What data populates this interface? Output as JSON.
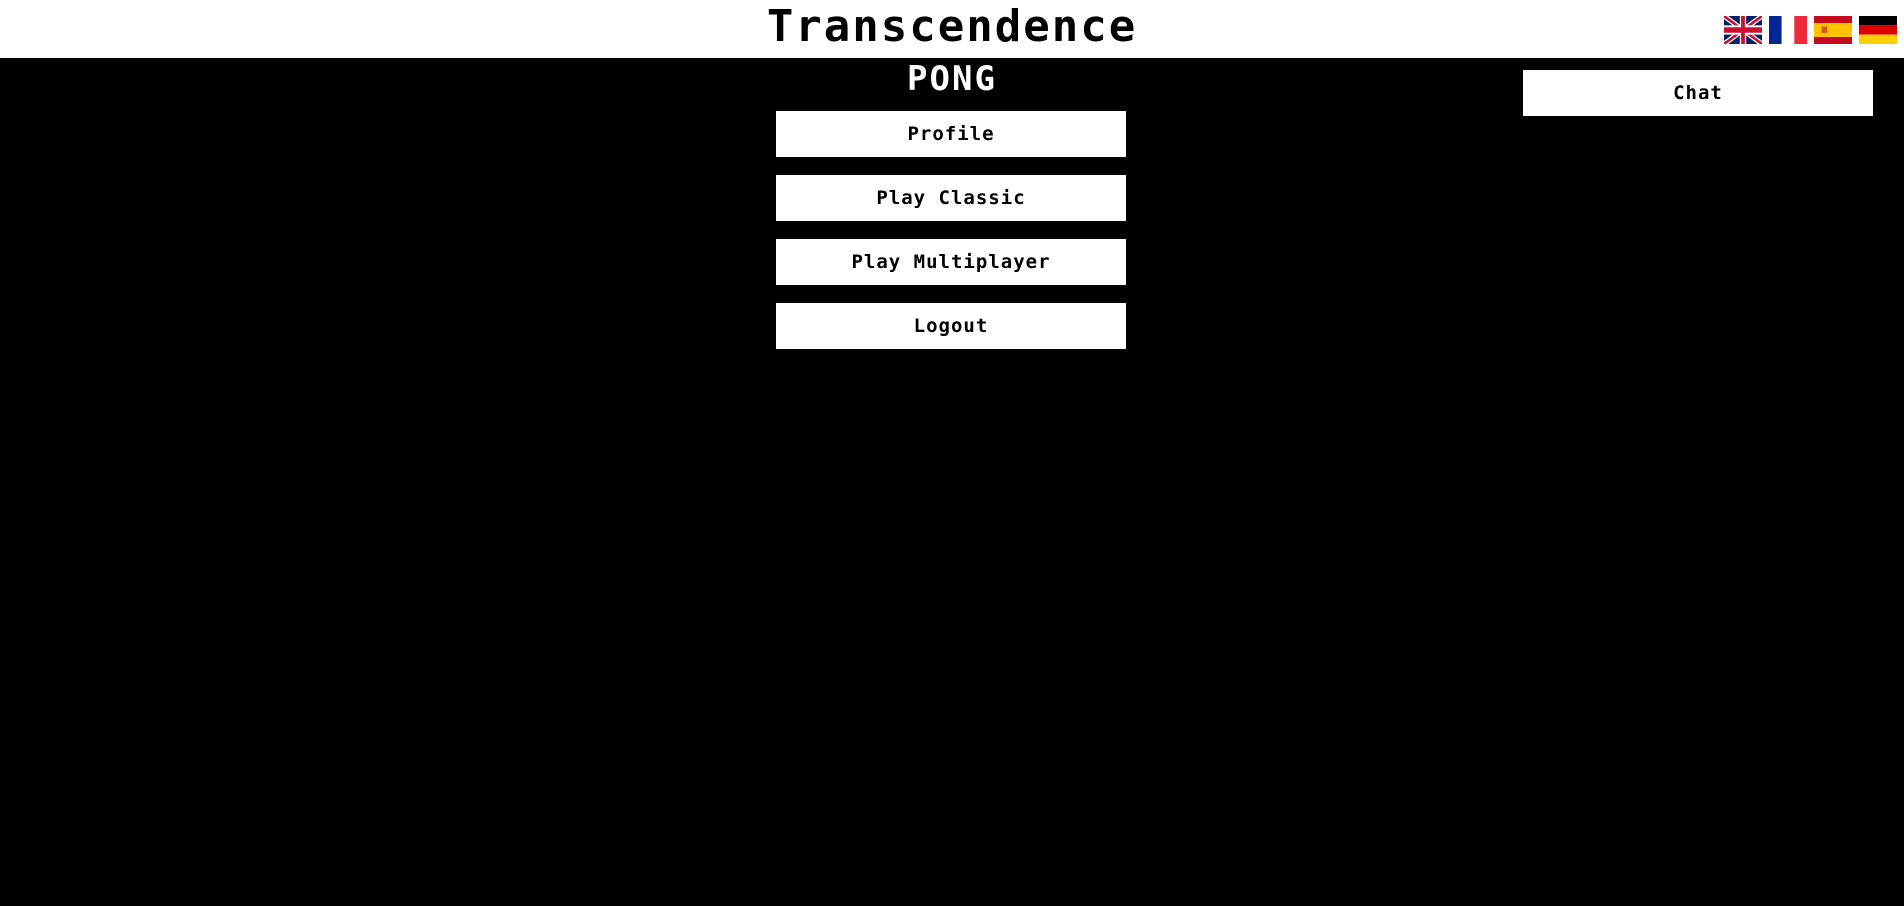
{
  "header": {
    "title": "Transcendence"
  },
  "languages": [
    {
      "name": "uk-flag-icon",
      "code": "en"
    },
    {
      "name": "france-flag-icon",
      "code": "fr"
    },
    {
      "name": "spain-flag-icon",
      "code": "es"
    },
    {
      "name": "germany-flag-icon",
      "code": "de"
    }
  ],
  "main": {
    "title": "PONG",
    "menu": {
      "profile_label": "Profile",
      "play_classic_label": "Play Classic",
      "play_multiplayer_label": "Play Multiplayer",
      "logout_label": "Logout"
    },
    "chat_label": "Chat"
  },
  "colors": {
    "background": "#000000",
    "header_background": "#ffffff",
    "button_background": "#ffffff",
    "button_text": "#000000"
  }
}
